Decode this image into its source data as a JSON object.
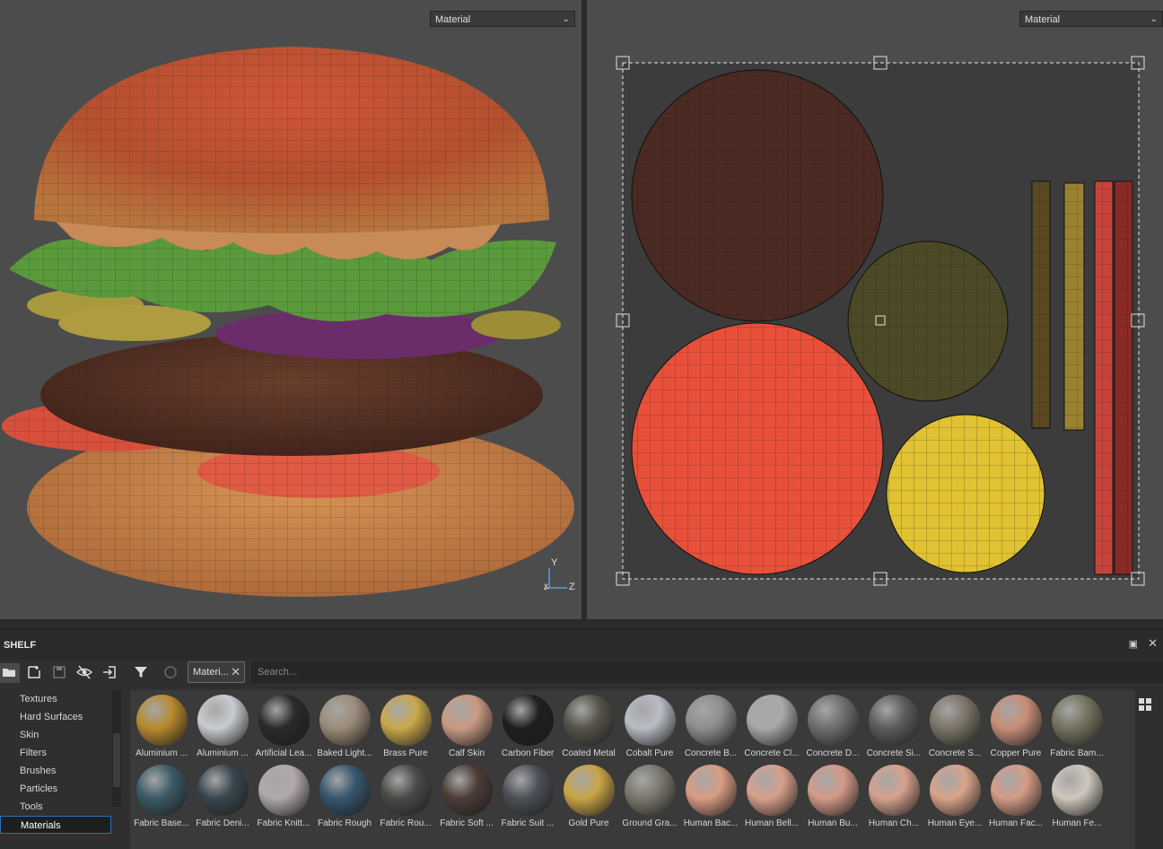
{
  "viewports": {
    "left": {
      "mode": "Material"
    },
    "right": {
      "mode": "Material"
    },
    "axis_labels": {
      "x": "x",
      "y": "Y",
      "z": "Z"
    }
  },
  "shelf": {
    "title": "SHELF",
    "filter_chip": "Materi...",
    "search_placeholder": "Search...",
    "categories": [
      {
        "label": "Textures"
      },
      {
        "label": "Hard Surfaces"
      },
      {
        "label": "Skin"
      },
      {
        "label": "Filters"
      },
      {
        "label": "Brushes"
      },
      {
        "label": "Particles"
      },
      {
        "label": "Tools"
      },
      {
        "label": "Materials",
        "selected": true
      }
    ],
    "materials_row1": [
      {
        "label": "Aluminium ...",
        "color": "#b8892e"
      },
      {
        "label": "Aluminium ...",
        "color": "#c8ccd0"
      },
      {
        "label": "Artificial Lea...",
        "color": "#2a2a2c"
      },
      {
        "label": "Baked Light...",
        "color": "#9c8c7a"
      },
      {
        "label": "Brass Pure",
        "color": "#c9a84a"
      },
      {
        "label": "Calf Skin",
        "color": "#c99a84"
      },
      {
        "label": "Carbon Fiber",
        "color": "#1f1f22"
      },
      {
        "label": "Coated Metal",
        "color": "#55534a"
      },
      {
        "label": "Cobalt Pure",
        "color": "#b8bcc4"
      },
      {
        "label": "Concrete B...",
        "color": "#8e8e8c"
      },
      {
        "label": "Concrete Cl...",
        "color": "#a7a9ab"
      },
      {
        "label": "Concrete D...",
        "color": "#6e6e6e"
      },
      {
        "label": "Concrete Si...",
        "color": "#5a5c5e"
      },
      {
        "label": "Concrete S...",
        "color": "#7a7566"
      },
      {
        "label": "Copper Pure",
        "color": "#c88e78"
      },
      {
        "label": "Fabric Bam...",
        "color": "#74735e"
      }
    ],
    "materials_row2": [
      {
        "label": "Fabric Base...",
        "color": "#3b5a66"
      },
      {
        "label": "Fabric Deni...",
        "color": "#39464e"
      },
      {
        "label": "Fabric Knitt...",
        "color": "#b0a8aa"
      },
      {
        "label": "Fabric Rough",
        "color": "#36566e"
      },
      {
        "label": "Fabric Rou...",
        "color": "#4a4a48"
      },
      {
        "label": "Fabric Soft ...",
        "color": "#4c3c36"
      },
      {
        "label": "Fabric Suit ...",
        "color": "#4c5056"
      },
      {
        "label": "Gold Pure",
        "color": "#c9a446"
      },
      {
        "label": "Ground Gra...",
        "color": "#7a776e"
      },
      {
        "label": "Human Bac...",
        "color": "#d89c84"
      },
      {
        "label": "Human Bell...",
        "color": "#d8a08c"
      },
      {
        "label": "Human Bu...",
        "color": "#d49a88"
      },
      {
        "label": "Human Ch...",
        "color": "#d6a28e"
      },
      {
        "label": "Human Eye...",
        "color": "#d8a48c"
      },
      {
        "label": "Human Fac...",
        "color": "#d49c86"
      },
      {
        "label": "Human Fe...",
        "color": "#cfc6bc"
      }
    ]
  }
}
